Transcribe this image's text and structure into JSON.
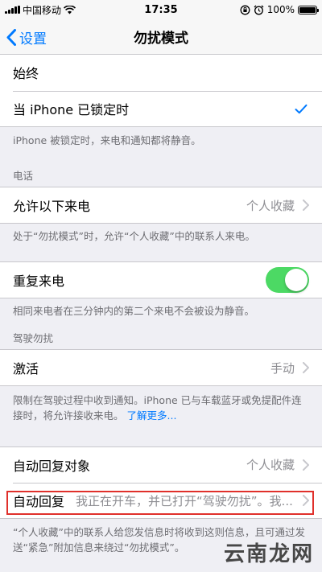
{
  "status": {
    "carrier": "中国移动",
    "time": "17:35",
    "battery": "100%",
    "battery_level": 1.0
  },
  "nav": {
    "back_label": "设置",
    "title": "勿扰模式"
  },
  "silence": {
    "always_label": "始终",
    "locked_label": "当 iPhone 已锁定时",
    "note": "iPhone 被锁定时，来电和通知都将静音。"
  },
  "phone": {
    "header": "电话",
    "allow_label": "允许以下来电",
    "allow_value": "个人收藏",
    "allow_note": "处于“勿扰模式”时，允许“个人收藏”中的联系人来电。",
    "repeat_label": "重复来电",
    "repeat_on": true,
    "repeat_note": "相同来电者在三分钟内的第二个来电不会被设为静音。"
  },
  "driving": {
    "header": "驾驶勿扰",
    "activate_label": "激活",
    "activate_value": "手动",
    "note": "限制在驾驶过程中收到通知。iPhone 已与车载蓝牙或免提配件连接时，将允许接收来电。",
    "learn_more": "了解更多...",
    "reply_to_label": "自动回复对象",
    "reply_to_value": "个人收藏",
    "auto_reply_label": "自动回复",
    "auto_reply_value": "我正在开车，并已打开“驾驶勿扰”。我...",
    "bottom_note": "“个人收藏”中的联系人给您发信息时将收到这则信息，且可通过发送“紧急”附加信息来绕过“勿扰模式”。"
  },
  "watermark": "云南龙网",
  "colors": {
    "accent": "#007aff",
    "toggle_on": "#4cd964",
    "highlight": "#e0302b"
  }
}
